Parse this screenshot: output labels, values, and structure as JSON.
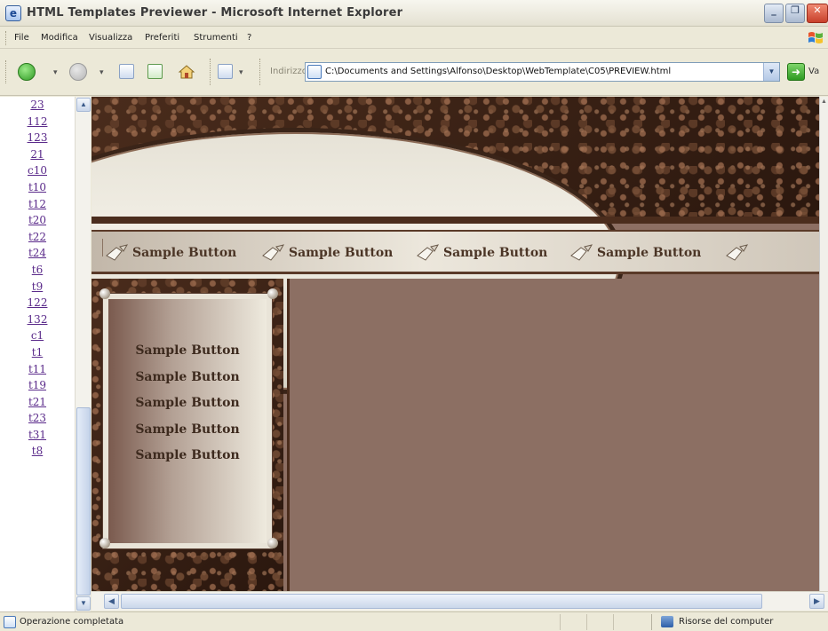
{
  "window": {
    "title": "HTML Templates Previewer - Microsoft Internet Explorer",
    "app_icon": "ie-icon",
    "minimize_glyph": "_",
    "maximize_glyph": "❐",
    "close_glyph": "✕"
  },
  "menu": {
    "items": [
      "File",
      "Modifica",
      "Visualizza",
      "Preferiti",
      "Strumenti",
      "?"
    ]
  },
  "toolbar": {
    "back_arrow": "▾",
    "forward_arrow": "▾",
    "address_label": "Indirizzo",
    "address_value": "C:\\Documents and Settings\\Alfonso\\Desktop\\WebTemplate\\C05\\PREVIEW.html",
    "go_glyph": "➜",
    "go_label": "Va"
  },
  "left_frame": {
    "links": [
      "23",
      "112",
      "123",
      "21",
      "c10",
      "t10",
      "t12",
      "t20",
      "t22",
      "t24",
      "t6",
      "t9",
      "122",
      "132",
      "c1",
      "t1",
      "t11",
      "t19",
      "t21",
      "t23",
      "t31",
      "t8"
    ],
    "scroll_up": "▲",
    "scroll_down": "▼"
  },
  "template": {
    "nav_buttons": [
      "Sample Button",
      "Sample Button",
      "Sample Button",
      "Sample Button"
    ],
    "side_buttons": [
      "Sample Button",
      "Sample Button",
      "Sample Button",
      "Sample Button",
      "Sample Button"
    ],
    "colors": {
      "background": "#8c6f63",
      "texture_dark": "#3a2418",
      "arch_light": "#eeeae0",
      "nav_text": "#4b3526"
    }
  },
  "hscroll": {
    "left": "◀",
    "right": "▶"
  },
  "status": {
    "text": "Operazione completata",
    "zone": "Risorse del computer"
  }
}
